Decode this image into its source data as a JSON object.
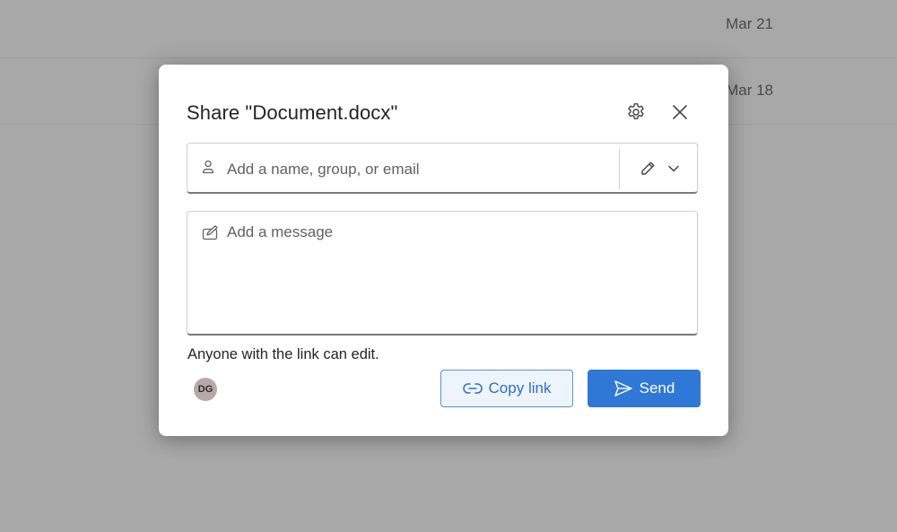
{
  "background": {
    "rows": [
      {
        "date": "Mar 21"
      },
      {
        "date": "Mar 18"
      }
    ]
  },
  "dialog": {
    "title": "Share \"Document.docx\"",
    "people_input": {
      "value": "",
      "placeholder": "Add a name, group, or email",
      "icon": "person-icon"
    },
    "permission_dropdown": {
      "icon": "pencil-icon",
      "chevron": "chevron-down-icon"
    },
    "message_input": {
      "value": "",
      "placeholder": "Add a message",
      "icon": "compose-icon"
    },
    "link_info": "Anyone with the link can edit.",
    "avatar_initials": "DG",
    "copy_link_label": "Copy link",
    "send_label": "Send"
  },
  "colors": {
    "primary": "#2f78d6",
    "copy_link_text": "#2f6fc7",
    "copy_link_bg": "#eef4fb",
    "overlay": "#a8a8a8",
    "avatar_bg": "#b9a8ab"
  }
}
